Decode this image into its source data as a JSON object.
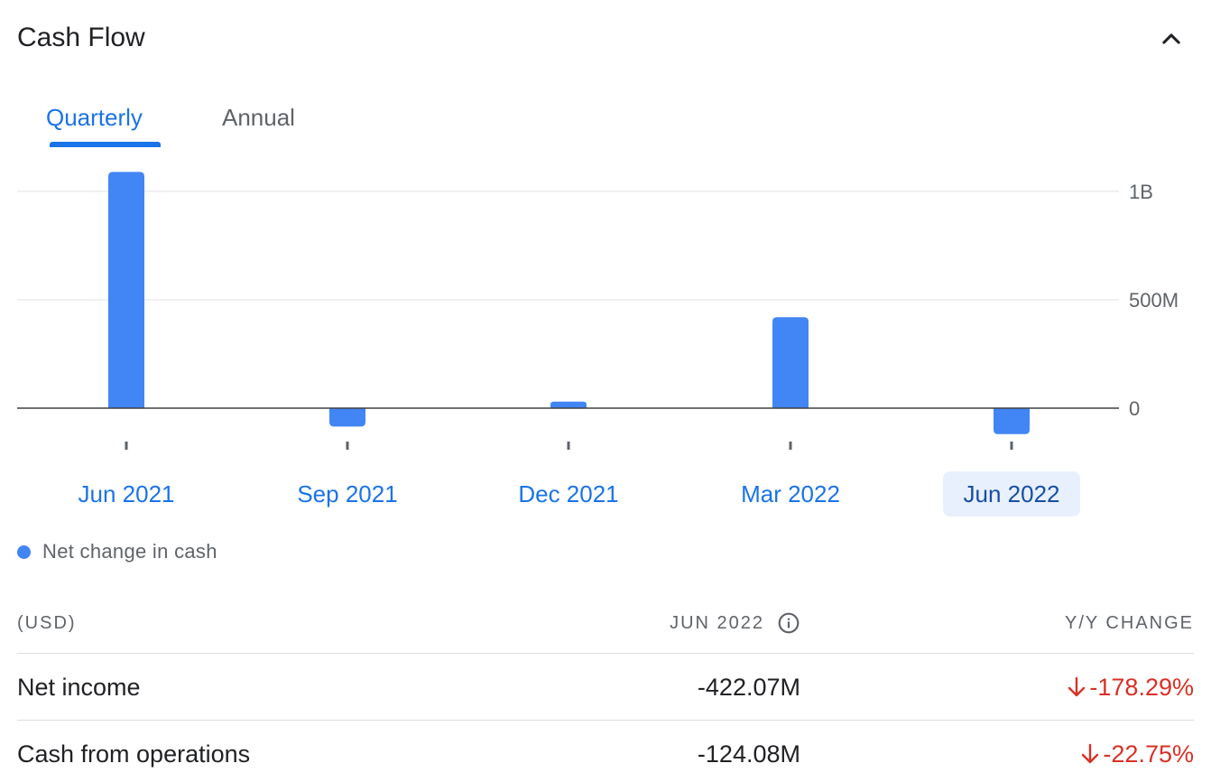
{
  "header": {
    "title": "Cash Flow",
    "collapse_icon": "chevron-up-icon"
  },
  "tabs": [
    {
      "label": "Quarterly",
      "active": true
    },
    {
      "label": "Annual",
      "active": false
    }
  ],
  "chart_data": {
    "type": "bar",
    "categories": [
      "Jun 2021",
      "Sep 2021",
      "Dec 2021",
      "Mar 2022",
      "Jun 2022"
    ],
    "series": [
      {
        "name": "Net change in cash",
        "values": [
          1090,
          -85,
          30,
          420,
          -120
        ],
        "color": "#4285f4"
      }
    ],
    "unit": "M",
    "ylim": [
      -160,
      1100
    ],
    "yticks": [
      {
        "value": 1000,
        "label": "1B"
      },
      {
        "value": 500,
        "label": "500M"
      },
      {
        "value": 0,
        "label": "0"
      }
    ],
    "selected_category": "Jun 2022",
    "grid": true,
    "legend_position": "bottom-left"
  },
  "legend": {
    "label": "Net change in cash",
    "color": "#4285f4"
  },
  "table": {
    "headers": {
      "label": "(USD)",
      "period": "JUN 2022",
      "change": "Y/Y CHANGE"
    },
    "info_icon": "info-icon",
    "rows": [
      {
        "label": "Net income",
        "value": "-422.07M",
        "change": "-178.29%"
      },
      {
        "label": "Cash from operations",
        "value": "-124.08M",
        "change": "-22.75%"
      }
    ]
  },
  "colors": {
    "accent": "#1a73e8",
    "bar": "#4285f4",
    "negative": "#d93025",
    "selected_bg": "#e8f0fe"
  }
}
